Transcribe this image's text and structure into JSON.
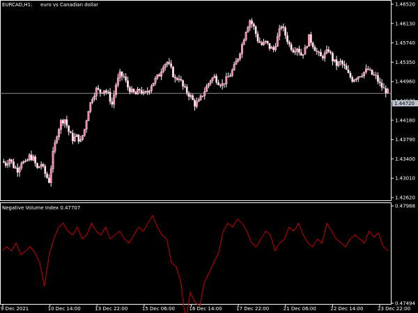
{
  "terminal": {
    "symbol_label": "EURCAD,H1:",
    "symbol_description": "euro vs Canadian dollar",
    "indicator_label": "Negative Volume Index 0.47707",
    "current_price": "1.44720",
    "colors": {
      "background": "#000000",
      "candle": "#ff7fa0",
      "candle_outline": "#ffffff",
      "indicator_line": "#cc0000",
      "grid_frame": "#ffffff",
      "price_line": "#8a8a8a"
    }
  },
  "chart_data": [
    {
      "type": "candlestick",
      "title": "",
      "y_ticks": [
        "1.46520",
        "1.46130",
        "1.45740",
        "1.45350",
        "1.44960",
        "1.44570",
        "1.44180",
        "1.43790",
        "1.43400",
        "1.43010",
        "1.42620"
      ],
      "ylim": [
        1.4262,
        1.4652
      ],
      "x_ticks": [
        "9 Dec 2021",
        "10 Dec 14:00",
        "13 Dec 22:00",
        "15 Dec 06:00",
        "16 Dec 14:00",
        "17 Dec 22:00",
        "21 Dec 06:00",
        "22 Dec 14:00",
        "23 Dec 22:00"
      ],
      "current_price": 1.4472,
      "close_path": [
        1.4335,
        1.433,
        1.434,
        1.4325,
        1.4318,
        1.4335,
        1.433,
        1.4345,
        1.434,
        1.432,
        1.433,
        1.431,
        1.4295,
        1.435,
        1.439,
        1.4415,
        1.442,
        1.4395,
        1.438,
        1.4385,
        1.4375,
        1.44,
        1.444,
        1.4465,
        1.448,
        1.4475,
        1.448,
        1.447,
        1.445,
        1.449,
        1.451,
        1.4505,
        1.4485,
        1.4475,
        1.447,
        1.448,
        1.447,
        1.4475,
        1.449,
        1.45,
        1.451,
        1.453,
        1.4535,
        1.452,
        1.45,
        1.4505,
        1.4485,
        1.4475,
        1.4465,
        1.445,
        1.4455,
        1.447,
        1.4485,
        1.45,
        1.4505,
        1.4495,
        1.449,
        1.45,
        1.451,
        1.4525,
        1.4545,
        1.457,
        1.46,
        1.462,
        1.4605,
        1.458,
        1.457,
        1.4575,
        1.4565,
        1.456,
        1.4585,
        1.461,
        1.459,
        1.457,
        1.456,
        1.4565,
        1.455,
        1.456,
        1.4585,
        1.457,
        1.4555,
        1.4545,
        1.455,
        1.456,
        1.454,
        1.453,
        1.4535,
        1.4525,
        1.451,
        1.45,
        1.4505,
        1.451,
        1.4515,
        1.452,
        1.451,
        1.4505,
        1.449,
        1.448,
        1.4475
      ]
    },
    {
      "type": "line",
      "title": "Negative Volume Index 0.47707",
      "y_ticks": [
        "0.47988",
        "0.47494"
      ],
      "ylim": [
        0.47494,
        0.47988
      ],
      "series": [
        {
          "values": [
            0.4776,
            0.4778,
            0.4776,
            0.478,
            0.4774,
            0.4776,
            0.4778,
            0.4775,
            0.477,
            0.4758,
            0.4774,
            0.4782,
            0.4788,
            0.479,
            0.4786,
            0.4784,
            0.4788,
            0.4782,
            0.4784,
            0.479,
            0.4786,
            0.4784,
            0.4788,
            0.4782,
            0.4784,
            0.4786,
            0.4782,
            0.478,
            0.4784,
            0.4788,
            0.4786,
            0.479,
            0.4794,
            0.4788,
            0.4784,
            0.4782,
            0.477,
            0.4768,
            0.476,
            0.474,
            0.4755,
            0.475,
            0.4748,
            0.476,
            0.4765,
            0.477,
            0.4775,
            0.4786,
            0.479,
            0.4788,
            0.4792,
            0.479,
            0.4786,
            0.478,
            0.4778,
            0.4782,
            0.4786,
            0.4784,
            0.4776,
            0.478,
            0.4782,
            0.4788,
            0.4786,
            0.479,
            0.4784,
            0.478,
            0.4778,
            0.4782,
            0.478,
            0.479,
            0.4786,
            0.4782,
            0.478,
            0.4778,
            0.4782,
            0.4784,
            0.4782,
            0.478,
            0.4786,
            0.4783,
            0.4785,
            0.4778,
            0.4776
          ]
        }
      ]
    }
  ]
}
